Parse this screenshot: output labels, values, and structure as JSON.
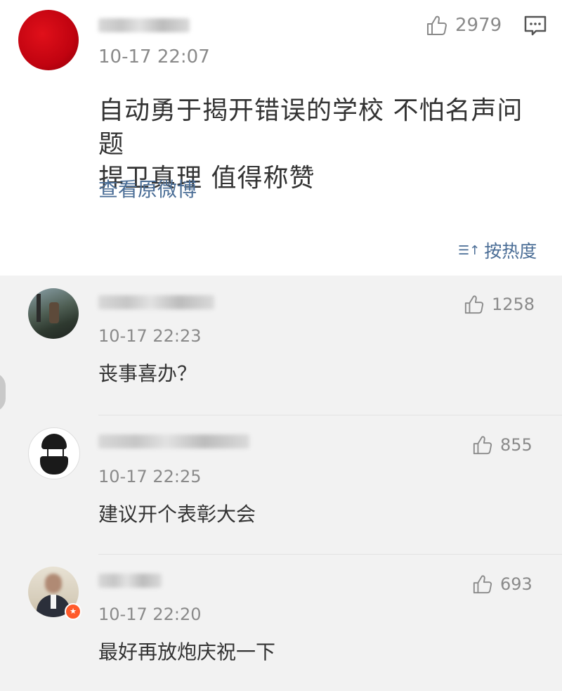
{
  "main_post": {
    "timestamp": "10-17 22:07",
    "likes": "2979",
    "text_line1": "自动勇于揭开错误的学校 不怕名声问题",
    "text_line2": "捍卫真理 值得称赞",
    "view_original": "查看原微博"
  },
  "sort": {
    "label": "按热度",
    "icon_glyph": "☰↑"
  },
  "comments": [
    {
      "timestamp": "10-17 22:23",
      "likes": "1258",
      "text": "丧事喜办？"
    },
    {
      "timestamp": "10-17 22:25",
      "likes": "855",
      "text": "建议开个表彰大会"
    },
    {
      "timestamp": "10-17 22:20",
      "likes": "693",
      "text": "最好再放炮庆祝一下"
    }
  ],
  "colors": {
    "link_blue": "#4a6d96",
    "gray_text": "#8a8a8a",
    "avatar_red": "#d10a14",
    "badge_orange": "#ff5a2a"
  },
  "icons": {
    "like": "thumbs-up-icon",
    "comment": "comment-bubble-icon",
    "sort": "sort-icon",
    "badge": "verified-badge-icon"
  }
}
